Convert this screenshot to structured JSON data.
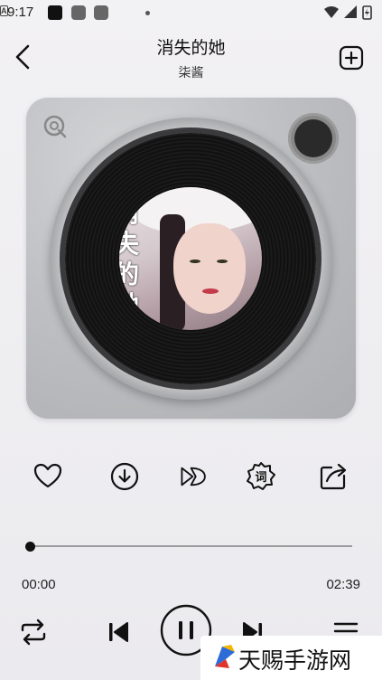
{
  "status_bar": {
    "time": "9:17",
    "notif_letter": "A"
  },
  "header": {
    "song_title": "消失的她",
    "artist": "柒酱"
  },
  "album_cover": {
    "text": "消失的她"
  },
  "player": {
    "current_time": "00:00",
    "total_time": "02:39",
    "progress": 0,
    "state": "playing"
  },
  "watermark": {
    "text": "天赐手游网"
  },
  "colors": {
    "background": "#eeedf0",
    "device": "#bfc0c3",
    "accent": "#111111"
  }
}
